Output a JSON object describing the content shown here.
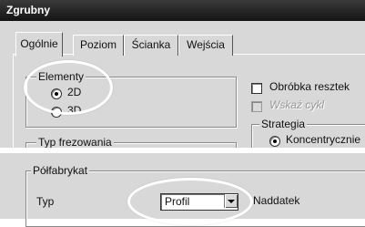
{
  "dialog": {
    "title": "Zgrubny",
    "tabs": [
      {
        "label": "Ogólnie",
        "active": true
      },
      {
        "label": "Poziom",
        "active": false
      },
      {
        "label": "Ścianka",
        "active": false
      },
      {
        "label": "Wejścia",
        "active": false
      }
    ],
    "elementy": {
      "label": "Elementy",
      "options": [
        {
          "label": "2D",
          "selected": true
        },
        {
          "label": "3D",
          "selected": false
        }
      ]
    },
    "obrobka_resztek": {
      "label": "Obróbka resztek",
      "checked": false
    },
    "wskaz_cykl": {
      "label": "Wskaż cykl",
      "checked": false,
      "disabled": true
    },
    "strategia": {
      "label": "Strategia",
      "options": [
        {
          "label": "Koncentrycznie",
          "selected": true
        }
      ]
    },
    "typ_frezowania": {
      "label": "Typ frezowania"
    }
  },
  "bottom": {
    "group_label": "Półfabrykat",
    "typ_label": "Typ",
    "typ_value": "Profil",
    "naddatek_label": "Naddatek"
  }
}
